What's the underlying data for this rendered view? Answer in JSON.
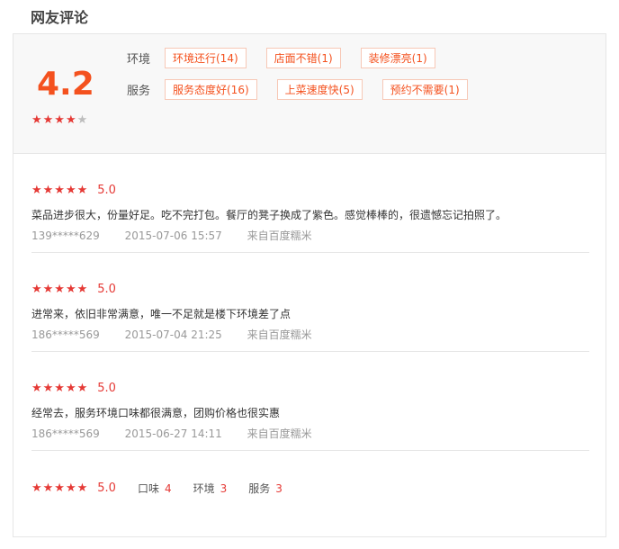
{
  "title": "网友评论",
  "overall": {
    "score": "4.2",
    "stars": "★★★★",
    "stars_off": "★",
    "rating": 4
  },
  "tags": {
    "env_label": "环境",
    "service_label": "服务",
    "env": [
      "环境还行(14)",
      "店面不错(1)",
      "装修漂亮(1)"
    ],
    "service": [
      "服务态度好(16)",
      "上菜速度快(5)",
      "预约不需要(1)"
    ]
  },
  "reviews": [
    {
      "stars": "★★★★★",
      "score": "5.0",
      "text": "菜品进步很大，份量好足。吃不完打包。餐厅的凳子换成了紫色。感觉棒棒的，很遗憾忘记拍照了。",
      "user": "139*****629",
      "date": "2015-07-06 15:57",
      "source": "来自百度糯米"
    },
    {
      "stars": "★★★★★",
      "score": "5.0",
      "text": "进常来，依旧非常满意，唯一不足就是楼下环境差了点",
      "user": "186*****569",
      "date": "2015-07-04 21:25",
      "source": "来自百度糯米"
    },
    {
      "stars": "★★★★★",
      "score": "5.0",
      "text": "经常去，服务环境口味都很满意，团购价格也很实惠",
      "user": "186*****569",
      "date": "2015-06-27 14:11",
      "source": "来自百度糯米"
    },
    {
      "stars": "★★★★★",
      "score": "5.0",
      "text": "",
      "user": "",
      "date": "",
      "source": "",
      "sub": [
        {
          "label": "口味",
          "value": "4"
        },
        {
          "label": "环境",
          "value": "3"
        },
        {
          "label": "服务",
          "value": "3"
        }
      ]
    }
  ]
}
